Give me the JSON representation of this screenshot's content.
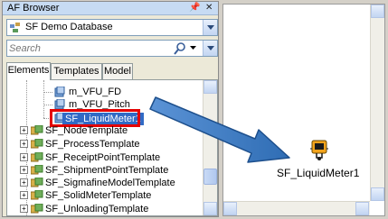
{
  "browser": {
    "title": "AF Browser",
    "pin_icon": "pin-icon",
    "close_icon": "close-icon",
    "database": "SF Demo Database",
    "search_placeholder": "Search",
    "tabs": [
      "Elements",
      "Templates",
      "Model"
    ],
    "active_tab": "Elements"
  },
  "tree": {
    "children": [
      "m_VFU_FD",
      "m_VFU_Pitch",
      "SF_LiquidMeter1"
    ],
    "selected": "SF_LiquidMeter1",
    "templates": [
      "SF_NodeTemplate",
      "SF_ProcessTemplate",
      "SF_ReceiptPointTemplate",
      "SF_ShipmentPointTemplate",
      "SF_SigmafineModelTemplate",
      "SF_SolidMeterTemplate",
      "SF_UnloadingTemplate"
    ]
  },
  "canvas": {
    "element_label": "SF_LiquidMeter1",
    "element_icon": "liquid-meter-icon"
  },
  "colors": {
    "highlight_box": "#e40000",
    "arrow": "#2f6db4",
    "selection": "#316ac5"
  }
}
